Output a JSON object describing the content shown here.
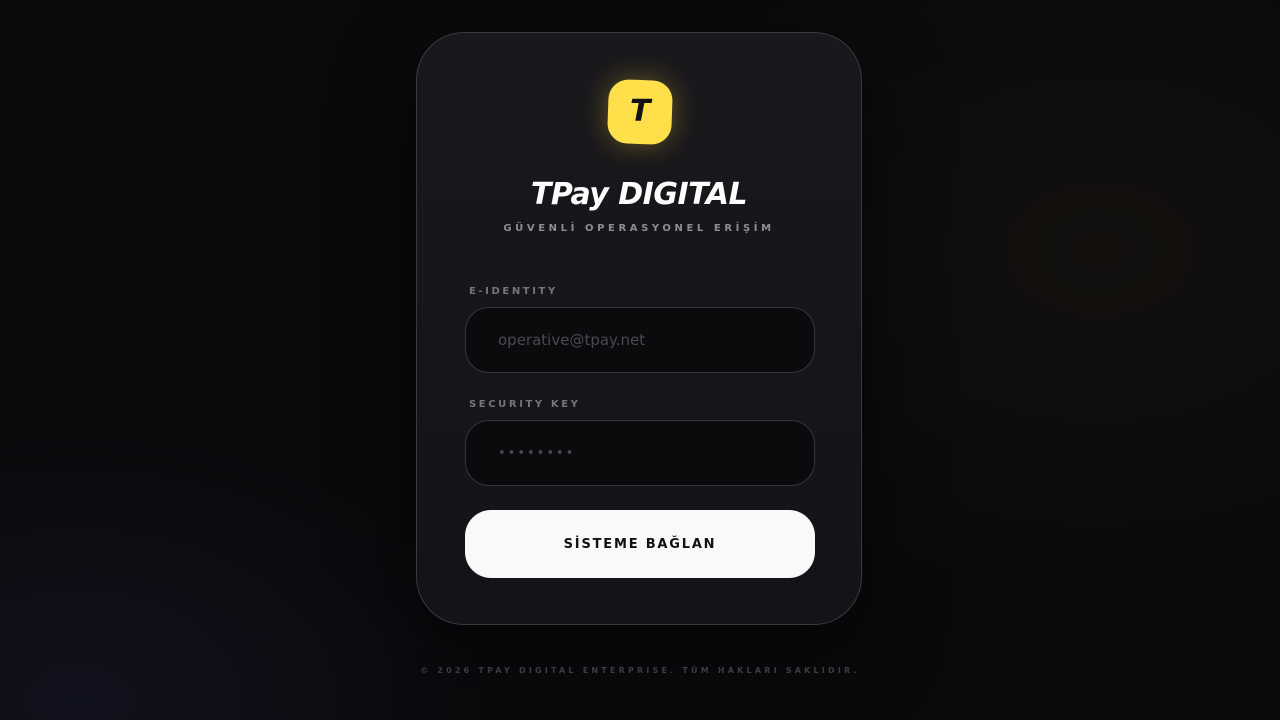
{
  "brand": {
    "logo_letter": "T",
    "title": "TPay DIGITAL",
    "subtitle": "GÜVENLİ OPERASYONEL ERİŞİM",
    "accent_color": "#ffe04a"
  },
  "form": {
    "email_label": "E-IDENTITY",
    "email_placeholder": "operative@tpay.net",
    "email_value": "",
    "key_label": "SECURITY KEY",
    "key_placeholder": "••••••••",
    "key_value": "",
    "submit_label": "SİSTEME BAĞLAN"
  },
  "footer": {
    "copyright": "© 2026 TPAY DIGITAL ENTERPRISE. TÜM HAKLARI SAKLIDIR."
  }
}
